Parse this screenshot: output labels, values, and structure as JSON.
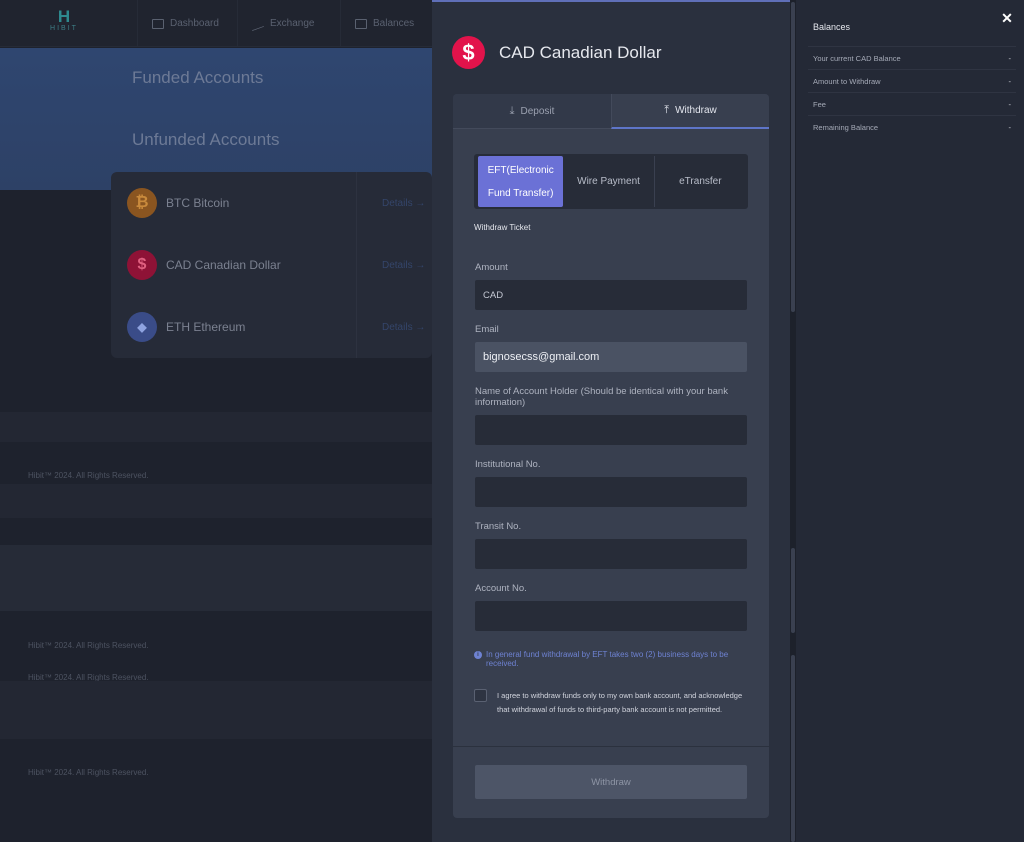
{
  "background": {
    "logo": {
      "mark": "H",
      "word": "HIBIT"
    },
    "nav": [
      {
        "label": "Dashboard"
      },
      {
        "label": "Exchange"
      },
      {
        "label": "Balances"
      }
    ],
    "hero": {
      "funded": "Funded Accounts",
      "unfunded": "Unfunded Accounts"
    },
    "accounts": [
      {
        "symbol": "₿",
        "name": "BTC Bitcoin",
        "details": "Details →",
        "color": "#b36b22"
      },
      {
        "symbol": "$",
        "name": "CAD Canadian Dollar",
        "details": "Details →",
        "color": "#b0123e"
      },
      {
        "symbol": "◆",
        "name": "ETH Ethereum",
        "details": "Details →",
        "color": "#4a5fa8"
      }
    ],
    "footer": [
      "Hibit™ 2024. All Rights Reserved.",
      "Hibit™ 2024. All Rights Reserved.",
      "Hibit™ 2024. All Rights Reserved.",
      "Hibit™ 2024. All Rights Reserved."
    ]
  },
  "modal": {
    "icon": "$",
    "title": "CAD Canadian Dollar",
    "tabs": [
      {
        "label": "Deposit",
        "icon": "download-icon"
      },
      {
        "label": "Withdraw",
        "icon": "upload-icon"
      }
    ],
    "methods": {
      "eft": [
        "EFT(Electronic",
        "Fund Transfer)"
      ],
      "wire": "Wire Payment",
      "etransfer": "eTransfer"
    },
    "ticket_title": "Withdraw Ticket",
    "fields": {
      "amount_label": "Amount",
      "amount_placeholder": "CAD",
      "email_label": "Email",
      "email_value": "bignosecss@gmail.com",
      "holder_label": "Name of Account Holder (Should be identical with your bank information)",
      "institution_label": "Institutional No.",
      "transit_label": "Transit No.",
      "account_label": "Account No."
    },
    "info": "In general fund withdrawal by EFT takes two (2) business days to be received.",
    "agree": "I agree to withdraw funds only to my own bank account, and acknowledge that withdrawal of funds to third-party bank account is not permitted.",
    "submit": "Withdraw",
    "accent": "#6b71d6"
  },
  "balances": {
    "title": "Balances",
    "rows": [
      {
        "label": "Your current CAD Balance",
        "value": "-"
      },
      {
        "label": "Amount to Withdraw",
        "value": "-"
      },
      {
        "label": "Fee",
        "value": "-"
      },
      {
        "label": "Remaining Balance",
        "value": "-"
      }
    ]
  }
}
